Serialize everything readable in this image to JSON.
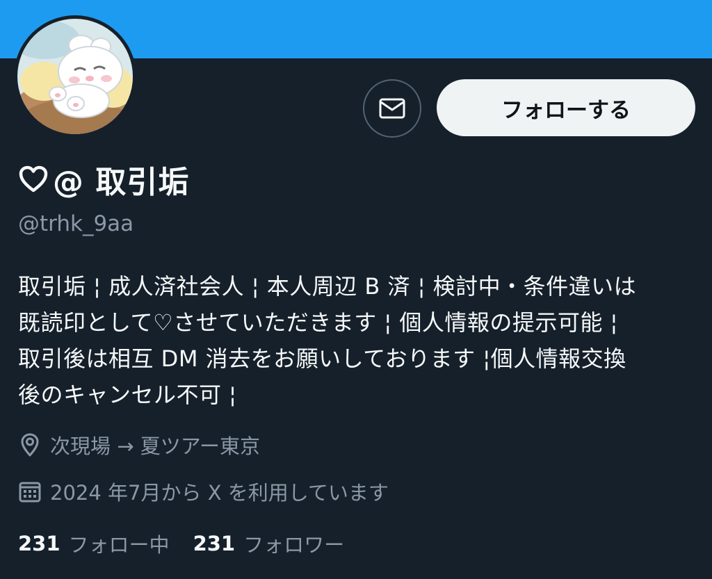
{
  "profile": {
    "display_name": "@ 取引垢",
    "handle": "@trhk_9aa",
    "avatar_icon": "bear-character-avatar",
    "name_icon": "heart-outline-icon"
  },
  "actions": {
    "message_icon": "mail-icon",
    "follow_label": "フォローする"
  },
  "bio": {
    "lines": [
      "取引垢 ¦ 成人済社会人 ¦ 本人周辺 B 済 ¦ 検討中・条件違いは",
      "既読印として♡させていただきます ¦ 個人情報の提示可能 ¦",
      "取引後は相互 DM 消去をお願いしております ¦個人情報交換",
      "後のキャンセル不可 ¦"
    ]
  },
  "meta": {
    "location_icon": "location-pin-icon",
    "location": "次現場 → 夏ツアー東京",
    "joined_icon": "calendar-icon",
    "joined": "2024 年7月から X を利用しています"
  },
  "stats": {
    "following_count": "231",
    "following_label": "フォロー中",
    "followers_count": "231",
    "followers_label": "フォロワー"
  },
  "colors": {
    "background": "#15202b",
    "banner": "#1d9bf0",
    "text_primary": "#f7f9f9",
    "text_secondary": "#8b98a5",
    "button_bg": "#eff3f4"
  }
}
